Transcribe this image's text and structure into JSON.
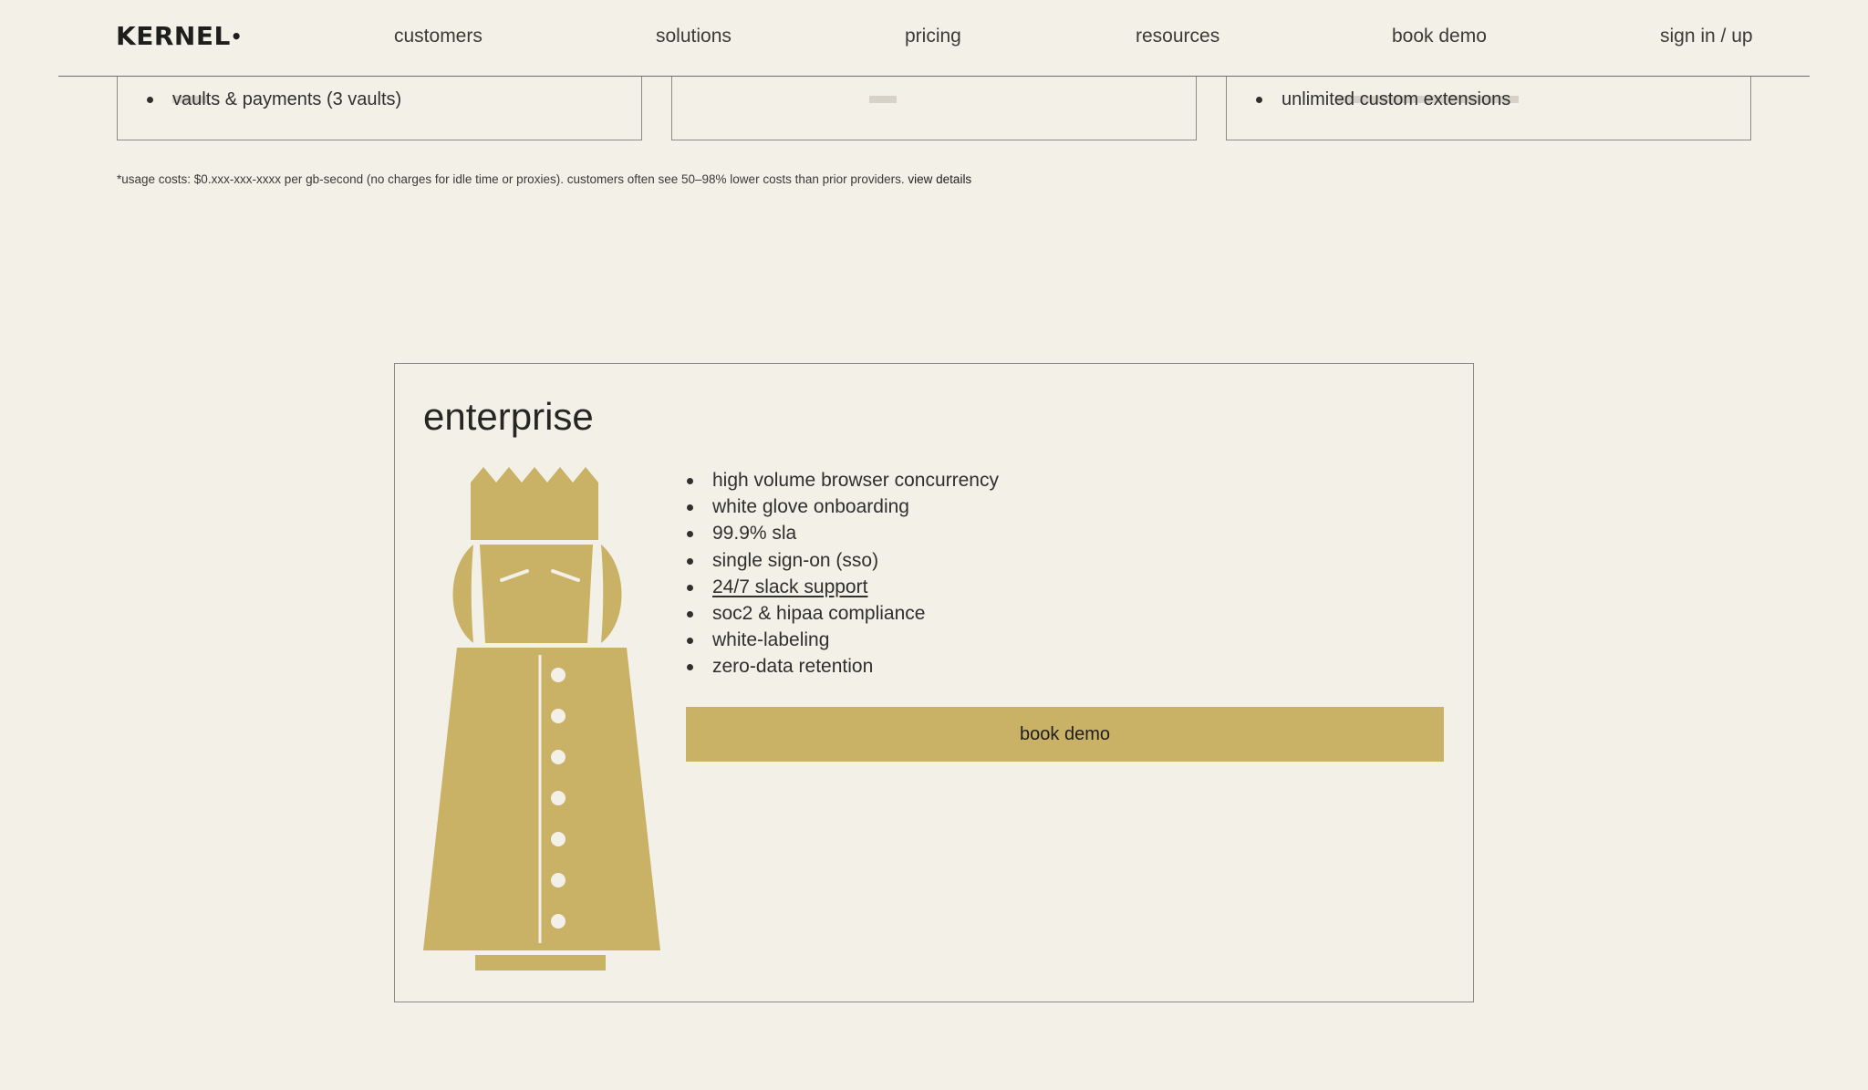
{
  "nav": {
    "logo": "KERNEL",
    "logo_mark": "•",
    "links": [
      "customers",
      "solutions",
      "pricing",
      "resources",
      "book demo",
      "sign in / up"
    ]
  },
  "plans": [
    {
      "features": [
        "vaults & payments (3 vaults)"
      ]
    },
    {
      "features": []
    },
    {
      "features": [
        "unlimited custom extensions"
      ]
    }
  ],
  "footnote": {
    "text": "*usage costs: $0.xxx-xxx-xxxx per gb-second (no charges for idle time or proxies). customers often see 50–98% lower costs than prior providers.",
    "link": "view details"
  },
  "enterprise": {
    "title": "enterprise",
    "features": [
      "high volume browser concurrency",
      "white glove onboarding",
      "99.9% sla",
      "single sign-on (sso)",
      "24/7 slack support",
      "soc2 & hipaa compliance",
      "white-labeling",
      "zero-data retention"
    ],
    "cta": "book demo",
    "mascot_icon": "king-figure-icon"
  },
  "colors": {
    "background": "#f3f0e8",
    "accent": "#c9b166",
    "text": "#2a2a28"
  }
}
